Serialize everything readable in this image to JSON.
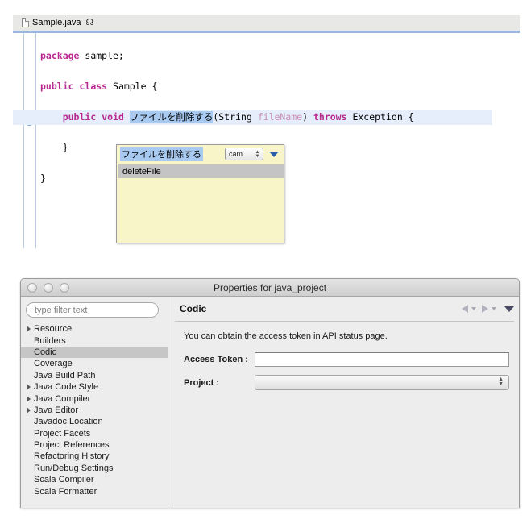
{
  "editor": {
    "tab": {
      "label": "Sample.java",
      "close_icon": "close-icon",
      "file_icon": "java-file-icon"
    },
    "code": {
      "line1_kw": "package",
      "line1_rest": " sample;",
      "line3_kw1": "public",
      "line3_kw2": "class",
      "line3_name": " Sample {",
      "line5_indent": "    ",
      "line5_kw1": "public",
      "line5_kw2": "void",
      "line5_method": "ファイルを削除する",
      "line5_paren_open": "(String ",
      "line5_param": "fileName",
      "line5_paren_close": ") ",
      "line5_kw3": "throws",
      "line5_tail": " Exception {",
      "line7": "    }",
      "line9": "}"
    },
    "fold_marker_icon": "collapse-fold-icon"
  },
  "popup": {
    "method_name": "ファイルを削除する",
    "case_option": "cam",
    "menu_arrow_icon": "dropdown-triangle-icon",
    "suggestion": "deleteFile"
  },
  "dialog": {
    "title": "Properties for java_project",
    "filter_placeholder": "type filter text",
    "filter_value": "type filter text",
    "tree": [
      {
        "label": "Resource",
        "expandable": true,
        "selected": false
      },
      {
        "label": "Builders",
        "expandable": false,
        "selected": false
      },
      {
        "label": "Codic",
        "expandable": false,
        "selected": true
      },
      {
        "label": "Coverage",
        "expandable": false,
        "selected": false
      },
      {
        "label": "Java Build Path",
        "expandable": false,
        "selected": false
      },
      {
        "label": "Java Code Style",
        "expandable": true,
        "selected": false
      },
      {
        "label": "Java Compiler",
        "expandable": true,
        "selected": false
      },
      {
        "label": "Java Editor",
        "expandable": true,
        "selected": false
      },
      {
        "label": "Javadoc Location",
        "expandable": false,
        "selected": false
      },
      {
        "label": "Project Facets",
        "expandable": false,
        "selected": false
      },
      {
        "label": "Project References",
        "expandable": false,
        "selected": false
      },
      {
        "label": "Refactoring History",
        "expandable": false,
        "selected": false
      },
      {
        "label": "Run/Debug Settings",
        "expandable": false,
        "selected": false
      },
      {
        "label": "Scala Compiler",
        "expandable": false,
        "selected": false
      },
      {
        "label": "Scala Formatter",
        "expandable": false,
        "selected": false
      }
    ],
    "page": {
      "title": "Codic",
      "description": "You can obtain the access token in API status page.",
      "access_token_label": "Access Token :",
      "access_token_value": "",
      "project_label": "Project :",
      "project_value": ""
    },
    "nav": {
      "back_icon": "back-arrow-icon",
      "forward_icon": "forward-arrow-icon",
      "menu_icon": "view-menu-icon"
    },
    "window_controls": {
      "close": "close-window-button",
      "minimize": "minimize-window-button",
      "zoom": "zoom-window-button"
    }
  },
  "colors": {
    "keyword": "#b8288f",
    "parameter": "#c98fb6",
    "selection": "#a8c9f0",
    "popup_bg": "#f8f6c8",
    "tab_underline": "#9bb7e0",
    "tree_selected": "#c6c6c6"
  }
}
